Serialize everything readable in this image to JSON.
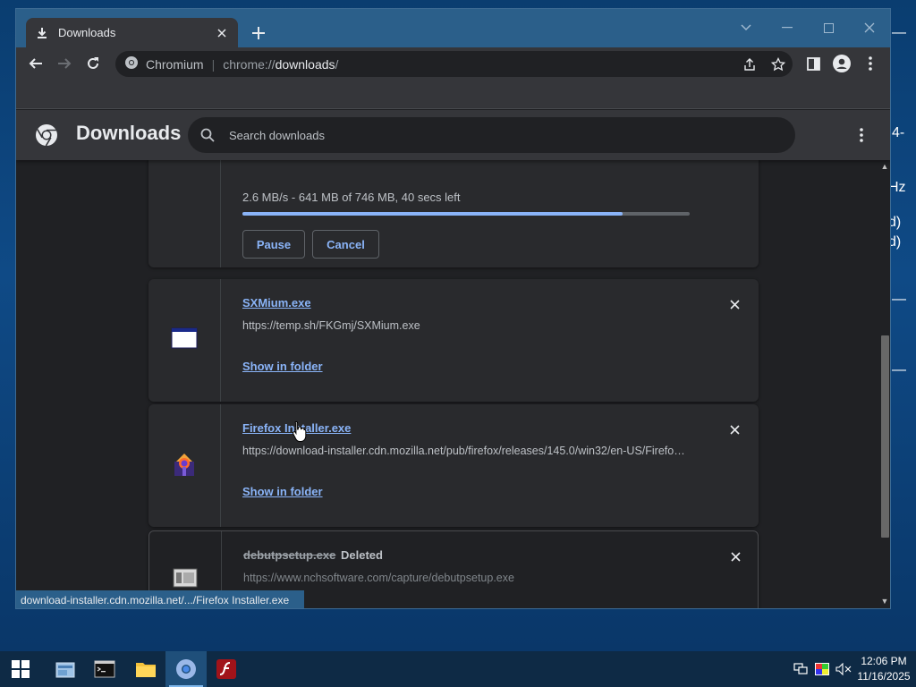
{
  "desktop": {
    "fragments": [
      "4-",
      "Hz",
      "d)",
      "d)",
      "—",
      "—",
      "—"
    ]
  },
  "window": {
    "tab": {
      "title": "Downloads"
    }
  },
  "toolbar": {
    "site_name": "Chromium",
    "url_scheme": "chrome://",
    "url_host": "downloads",
    "url_path": "/"
  },
  "downloads_page": {
    "title": "Downloads",
    "search_placeholder": "Search downloads",
    "items": [
      {
        "status": "2.6 MB/s - 641 MB of 746 MB, 40 secs left",
        "progress": 0.85,
        "pause_label": "Pause",
        "cancel_label": "Cancel"
      },
      {
        "name": "SXMium.exe",
        "url": "https://temp.sh/FKGmj/SXMium.exe",
        "action_label": "Show in folder"
      },
      {
        "name": "Firefox Installer.exe",
        "url": "https://download-installer.cdn.mozilla.net/pub/firefox/releases/145.0/win32/en-US/Firefox Installer.exe",
        "action_label": "Show in folder"
      },
      {
        "name": "debutpsetup.exe",
        "tag": "Deleted",
        "url": "https://www.nchsoftware.com/capture/debutpsetup.exe"
      }
    ]
  },
  "status_bar": {
    "text": "download-installer.cdn.mozilla.net/.../Firefox Installer.exe"
  },
  "taskbar": {
    "time": "12:06 PM",
    "date": "11/16/2025"
  },
  "colors": {
    "accent": "#8ab4f8",
    "titlebar": "#2b5f8a",
    "surface": "#292a2d",
    "background": "#202124"
  }
}
